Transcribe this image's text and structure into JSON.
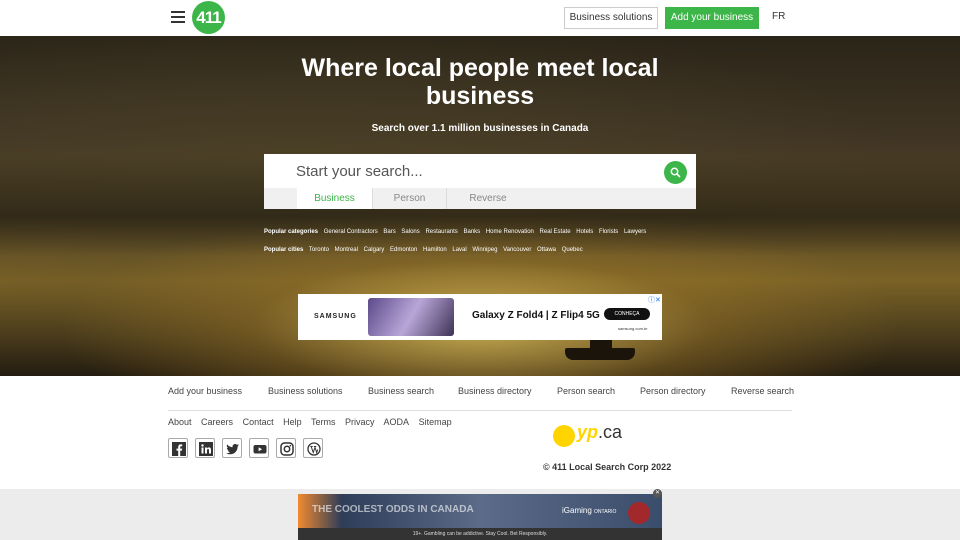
{
  "header": {
    "logo_text": "411",
    "business_solutions": "Business solutions",
    "add_business": "Add your business",
    "lang": "FR"
  },
  "hero": {
    "title": "Where local people meet local business",
    "subtitle": "Search over 1.1 million businesses in Canada",
    "search_placeholder": "Start your search...",
    "tabs": [
      "Business",
      "Person",
      "Reverse"
    ],
    "active_tab": "Business",
    "popular_categories_label": "Popular categories",
    "popular_categories": [
      "General Contractors",
      "Bars",
      "Salons",
      "Restaurants",
      "Banks",
      "Home Renovation",
      "Real Estate",
      "Hotels",
      "Florists",
      "Lawyers"
    ],
    "popular_cities_label": "Popular cities",
    "popular_cities": [
      "Toronto",
      "Montreal",
      "Calgary",
      "Edmonton",
      "Hamilton",
      "Laval",
      "Winnipeg",
      "Vancouver",
      "Ottawa",
      "Quebec"
    ]
  },
  "ad_top": {
    "brand": "SAMSUNG",
    "headline": "Galaxy Z Fold4 | Z Flip4 5G",
    "cta": "CONHEÇA",
    "site": "samsung.com.br"
  },
  "footer": {
    "nav": [
      "Add your business",
      "Business solutions",
      "Business search",
      "Business directory",
      "Person search",
      "Person directory",
      "Reverse search"
    ],
    "links": [
      "About",
      "Careers",
      "Contact",
      "Help",
      "Terms",
      "Privacy",
      "AODA",
      "Sitemap"
    ],
    "socials": [
      "facebook-icon",
      "linkedin-icon",
      "twitter-icon",
      "youtube-icon",
      "instagram-icon",
      "wordpress-icon"
    ],
    "yp_logo": "yp",
    "yp_suffix": ".ca",
    "copyright": "© 411 Local Search Corp 2022"
  },
  "ad_bottom": {
    "headline": "THE COOLEST ODDS IN CANADA",
    "brand": "iGaming",
    "brand_region": "ONTARIO",
    "disclaimer": "19+. Gambling can be addictive. Stay Cool. Bet Responsibly."
  },
  "colors": {
    "accent": "#3cb549",
    "yp_yellow": "#ffd400"
  }
}
